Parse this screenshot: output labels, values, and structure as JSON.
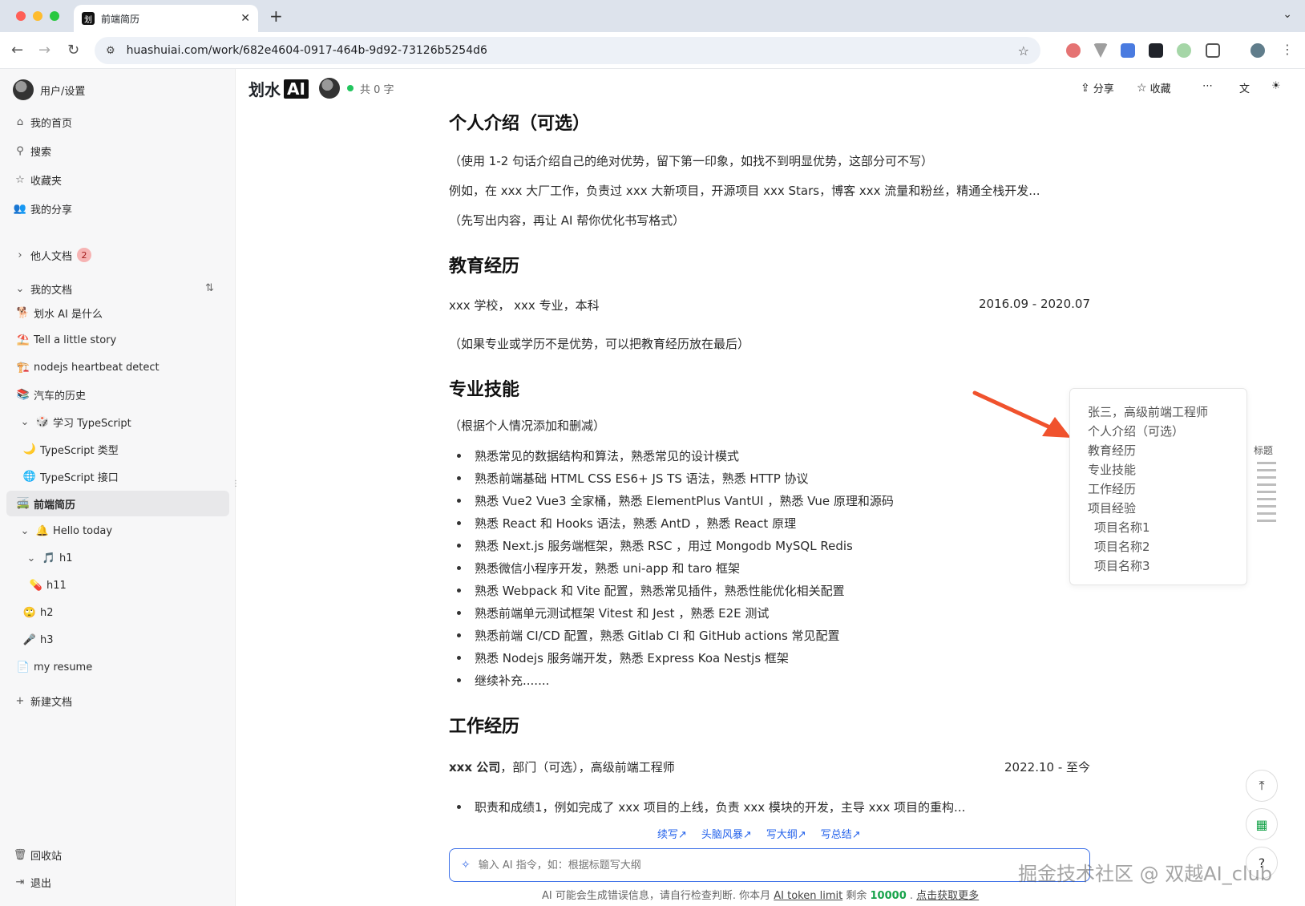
{
  "browser": {
    "tab_title": "前端简历",
    "tab_favicon": "划",
    "url": "huashuiai.com/work/682e4604-0917-464b-9d92-73126b5254d6"
  },
  "sidebar": {
    "user_label": "用户/设置",
    "nav": [
      {
        "icon": "home-icon",
        "label": "我的首页"
      },
      {
        "icon": "search-icon",
        "label": "搜索"
      },
      {
        "icon": "star-icon",
        "label": "收藏夹"
      },
      {
        "icon": "users-icon",
        "label": "我的分享"
      }
    ],
    "others_docs": {
      "label": "他人文档",
      "count": "2"
    },
    "my_docs_label": "我的文档",
    "docs": [
      {
        "emoji": "🐕",
        "label": "划水 AI 是什么"
      },
      {
        "emoji": "⛱️",
        "label": "Tell a little story"
      },
      {
        "emoji": "🏗️",
        "label": "nodejs heartbeat detect"
      },
      {
        "emoji": "📚",
        "label": "汽车的历史"
      },
      {
        "emoji": "🎲",
        "label": "学习 TypeScript"
      },
      {
        "emoji": "🌙",
        "label": "TypeScript 类型"
      },
      {
        "emoji": "🌐",
        "label": "TypeScript 接口"
      },
      {
        "emoji": "🚎",
        "label": "前端简历"
      },
      {
        "emoji": "🔔",
        "label": "Hello today"
      },
      {
        "emoji": "🎵",
        "label": "h1"
      },
      {
        "emoji": "💊",
        "label": "h11"
      },
      {
        "emoji": "🙄",
        "label": "h2"
      },
      {
        "emoji": "🎤",
        "label": "h3"
      },
      {
        "emoji": "📄",
        "label": "my resume"
      }
    ],
    "new_doc_label": "新建文档",
    "trash_label": "回收站",
    "logout_label": "退出"
  },
  "header": {
    "brand": "划水",
    "brand_ai": "AI",
    "word_count": "共 0 字",
    "share_label": "分享",
    "favorite_label": "收藏"
  },
  "doc": {
    "h_intro": "个人介绍（可选）",
    "intro_p1": "（使用 1-2 句话介绍自己的绝对优势，留下第一印象，如找不到明显优势，这部分可不写）",
    "intro_p2": "例如，在 xxx 大厂工作，负责过 xxx 大新项目，开源项目 xxx Stars，博客 xxx 流量和粉丝，精通全栈开发...",
    "intro_p3": "（先写出内容，再让 AI 帮你优化书写格式）",
    "h_edu": "教育经历",
    "edu_line": "xxx 学校， xxx 专业，本科",
    "edu_date": "2016.09 - 2020.07",
    "edu_note": "（如果专业或学历不是优势，可以把教育经历放在最后）",
    "h_skills": "专业技能",
    "skills_note": "（根据个人情况添加和删减）",
    "skills": [
      "熟悉常见的数据结构和算法，熟悉常见的设计模式",
      "熟悉前端基础 HTML CSS ES6+ JS TS 语法，熟悉 HTTP 协议",
      "熟悉 Vue2 Vue3 全家桶，熟悉 ElementPlus VantUI ，熟悉 Vue 原理和源码",
      "熟悉 React 和 Hooks 语法，熟悉 AntD ，熟悉 React 原理",
      "熟悉 Next.js 服务端框架，熟悉 RSC ，用过 Mongodb MySQL Redis",
      "熟悉微信小程序开发，熟悉 uni-app 和 taro 框架",
      "熟悉 Webpack 和 Vite 配置，熟悉常见插件，熟悉性能优化相关配置",
      "熟悉前端单元测试框架 Vitest 和 Jest ，熟悉 E2E 测试",
      "熟悉前端 CI/CD 配置，熟悉 Gitlab CI 和 GitHub actions 常见配置",
      "熟悉 Nodejs 服务端开发，熟悉 Express Koa Nestjs 框架",
      "继续补充......."
    ],
    "h_work": "工作经历",
    "work_company": "xxx 公司",
    "work_rest": "，部门（可选），高级前端工程师",
    "work_date": "2022.10 - 至今",
    "work_bullet": "职责和成绩1，例如完成了 xxx 项目的上线，负责 xxx 模块的开发，主导 xxx 项目的重构..."
  },
  "toc": {
    "label": "标题",
    "items": [
      "张三，高级前端工程师",
      "个人介绍（可选）",
      "教育经历",
      "专业技能",
      "工作经历",
      "项目经验"
    ],
    "sub_items": [
      "项目名称1",
      "项目名称2",
      "项目名称3"
    ]
  },
  "ai": {
    "actions": [
      "续写↗",
      "头脑风暴↗",
      "写大纲↗",
      "写总结↗"
    ],
    "placeholder": "输入 AI 指令，如：根据标题写大纲",
    "note_prefix": "AI 可能会生成错误信息，请自行检查判断. 你本月",
    "note_link": "AI token limit",
    "note_mid": "剩余",
    "note_count": "10000",
    "note_sep": ".",
    "note_more": "点击获取更多"
  },
  "watermark": "掘金技术社区 @ 双越AI_club",
  "colors": {
    "accent": "#3b6fe8",
    "arrow": "#f0522d",
    "green": "#16a34a"
  }
}
